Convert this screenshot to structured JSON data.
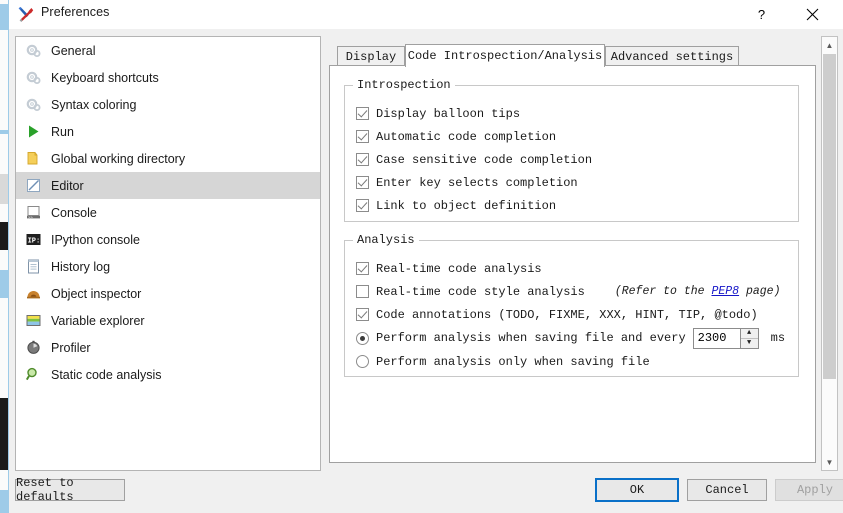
{
  "window": {
    "title": "Preferences",
    "icon": "tools-icon",
    "help_button": "?",
    "close_button": "✕"
  },
  "sidebar": {
    "items": [
      {
        "label": "General",
        "icon": "gear-icon",
        "selected": false
      },
      {
        "label": "Keyboard shortcuts",
        "icon": "gear-icon",
        "selected": false
      },
      {
        "label": "Syntax coloring",
        "icon": "gear-icon",
        "selected": false
      },
      {
        "label": "Run",
        "icon": "play-icon",
        "selected": false
      },
      {
        "label": "Global working directory",
        "icon": "folder-icon",
        "selected": false
      },
      {
        "label": "Editor",
        "icon": "editor-pencil-icon",
        "selected": true
      },
      {
        "label": "Console",
        "icon": "console-icon",
        "selected": false
      },
      {
        "label": "IPython console",
        "icon": "ipython-icon",
        "selected": false
      },
      {
        "label": "History log",
        "icon": "notebook-icon",
        "selected": false
      },
      {
        "label": "Object inspector",
        "icon": "object-inspector-icon",
        "selected": false
      },
      {
        "label": "Variable explorer",
        "icon": "variable-explorer-icon",
        "selected": false
      },
      {
        "label": "Profiler",
        "icon": "profiler-clock-icon",
        "selected": false
      },
      {
        "label": "Static code analysis",
        "icon": "magnifier-icon",
        "selected": false
      }
    ]
  },
  "tabs": [
    {
      "label": "Display",
      "active": false
    },
    {
      "label": "Code Introspection/Analysis",
      "active": true
    },
    {
      "label": "Advanced settings",
      "active": false
    }
  ],
  "introspection": {
    "title": "Introspection",
    "options": [
      {
        "label": "Display balloon tips",
        "checked": true
      },
      {
        "label": "Automatic code completion",
        "checked": true
      },
      {
        "label": "Case sensitive code completion",
        "checked": true
      },
      {
        "label": "Enter key selects completion",
        "checked": true
      },
      {
        "label": "Link to object definition",
        "checked": true
      }
    ]
  },
  "analysis": {
    "title": "Analysis",
    "realtime_code": {
      "label": "Real-time code analysis",
      "checked": true
    },
    "realtime_style": {
      "label": "Real-time code style analysis",
      "checked": false,
      "hint_prefix": "(Refer to the ",
      "hint_link": "PEP8",
      "hint_suffix": " page)"
    },
    "annotations": {
      "label": "Code annotations (TODO, FIXME, XXX, HINT, TIP, @todo)",
      "checked": true
    },
    "radio_saving_and_every": {
      "label": "Perform analysis when saving file and every",
      "selected": true
    },
    "interval_value": "2300",
    "interval_unit": "ms",
    "spin_up": "▲",
    "spin_down": "▼",
    "radio_only_saving": {
      "label": "Perform analysis only when saving file",
      "selected": false
    }
  },
  "scrollbar": {
    "up_arrow": "▲",
    "down_arrow": "▼"
  },
  "footer": {
    "reset": "Reset to defaults",
    "ok": "OK",
    "cancel": "Cancel",
    "apply": "Apply"
  },
  "colors": {
    "accent": "#0a70c8",
    "link": "#1515c8",
    "selection": "#d6d6d6",
    "dialog_bg": "#f0f0f0"
  }
}
